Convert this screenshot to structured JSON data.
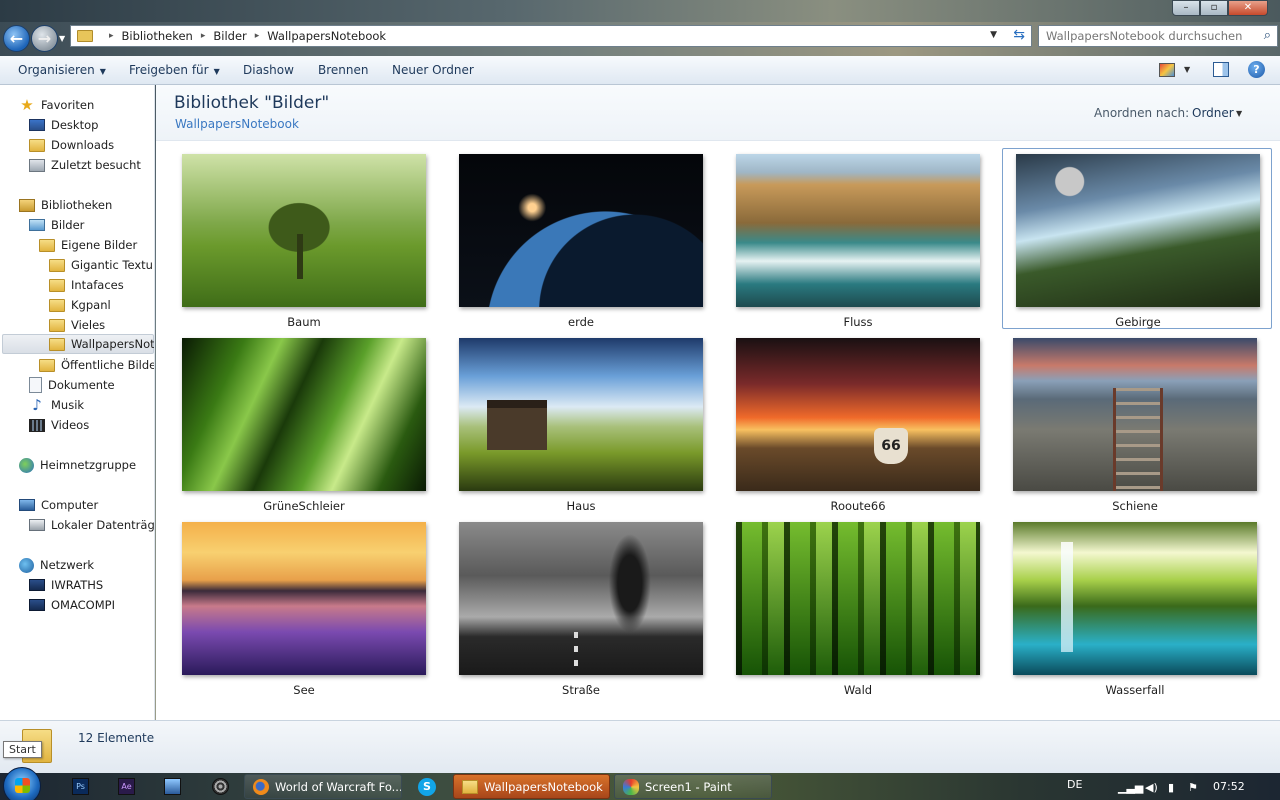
{
  "window": {
    "controls": {
      "minimize": "–",
      "maximize": "▫",
      "close": "✕"
    }
  },
  "nav": {
    "back_icon": "back-arrow-icon",
    "forward_icon": "forward-arrow-icon",
    "breadcrumbs": [
      "Bibliotheken",
      "Bilder",
      "WallpapersNotebook"
    ],
    "search_placeholder": "WallpapersNotebook durchsuchen"
  },
  "toolbar": {
    "organize": "Organisieren",
    "share": "Freigeben für",
    "slideshow": "Diashow",
    "burn": "Brennen",
    "new_folder": "Neuer Ordner"
  },
  "sidebar": {
    "favorites": "Favoriten",
    "desktop": "Desktop",
    "downloads": "Downloads",
    "recent": "Zuletzt besucht",
    "libraries": "Bibliotheken",
    "pictures": "Bilder",
    "my_pictures": "Eigene Bilder",
    "gigantic": "Gigantic Texture",
    "intafaces": "Intafaces",
    "kgpanl": "Kgpanl",
    "vieles": "Vieles",
    "wallpapers": "WallpapersNotebook",
    "public_pictures": "Öffentliche Bilder",
    "documents": "Dokumente",
    "music": "Musik",
    "videos": "Videos",
    "homegroup": "Heimnetzgruppe",
    "computer": "Computer",
    "local_disk": "Lokaler Datenträger",
    "network": "Netzwerk",
    "pc1": "IWRATHS",
    "pc2": "OMACOMPI"
  },
  "library": {
    "title": "Bibliothek \"Bilder\"",
    "subtitle": "WallpapersNotebook",
    "arrange_label": "Anordnen nach:",
    "arrange_value": "Ordner"
  },
  "files": [
    {
      "name": "Baum"
    },
    {
      "name": "erde"
    },
    {
      "name": "Fluss"
    },
    {
      "name": "Gebirge",
      "selected": true
    },
    {
      "name": "GrüneSchleier"
    },
    {
      "name": "Haus"
    },
    {
      "name": "Rooute66"
    },
    {
      "name": "Schiene"
    },
    {
      "name": "See"
    },
    {
      "name": "Straße"
    },
    {
      "name": "Wald"
    },
    {
      "name": "Wasserfall"
    }
  ],
  "details": {
    "count": "12 Elemente",
    "tooltip": "Start"
  },
  "taskbar": {
    "quicklaunch": {
      "ps": "Ps",
      "ae": "Ae"
    },
    "tasks": {
      "firefox": "World of Warcraft Fo...",
      "explorer": "WallpapersNotebook",
      "paint": "Screen1 - Paint"
    },
    "tray": {
      "lang": "DE",
      "time": "07:52"
    }
  }
}
